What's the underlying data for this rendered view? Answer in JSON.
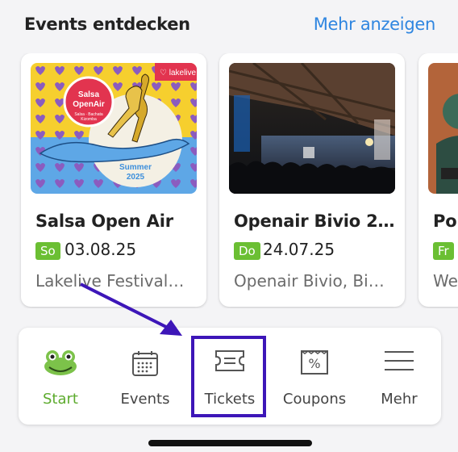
{
  "header": {
    "title": "Events entdecken",
    "more": "Mehr anzeigen"
  },
  "events": [
    {
      "title": "Salsa Open Air",
      "day": "So",
      "date": "03.08.25",
      "location": "Lakelive Festival…",
      "poster": {
        "brand": "lakelive",
        "badge_line1": "Salsa",
        "badge_line2": "OpenAir",
        "badge_sub1": "Salsa · Bachata",
        "badge_sub2": "Kizomba",
        "season": "Summer",
        "year": "2025"
      }
    },
    {
      "title": "Openair Bivio 2…",
      "day": "Do",
      "date": "24.07.25",
      "location": "Openair Bivio, Bi…"
    },
    {
      "title": "Pol",
      "day": "Fr",
      "date": "",
      "location": "We"
    }
  ],
  "nav": {
    "start": "Start",
    "events": "Events",
    "tickets": "Tickets",
    "coupons": "Coupons",
    "more": "Mehr"
  },
  "colors": {
    "accent_green": "#6bbf33",
    "link_blue": "#2f86e0",
    "annotation": "#3d16b8"
  }
}
